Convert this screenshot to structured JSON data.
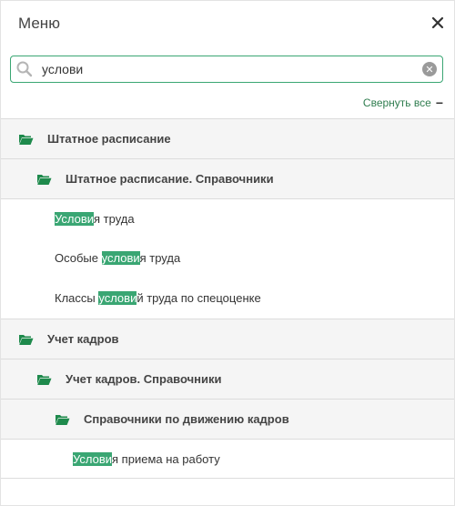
{
  "header": {
    "title": "Меню"
  },
  "search": {
    "value": "услови",
    "placeholder": ""
  },
  "collapse": {
    "label": "Свернуть все",
    "icon": "minus"
  },
  "colors": {
    "accent": "#3aa673",
    "folder": "#1e8a4c",
    "group_bg": "#f5f5f5"
  },
  "tree": [
    {
      "type": "group",
      "level": 0,
      "label": "Штатное расписание"
    },
    {
      "type": "group",
      "level": 1,
      "label": "Штатное расписание. Справочники"
    },
    {
      "type": "leaf",
      "level": 2,
      "pre": "",
      "match": "Услови",
      "post": "я труда"
    },
    {
      "type": "leaf",
      "level": 2,
      "pre": "Особые ",
      "match": "услови",
      "post": "я труда"
    },
    {
      "type": "leaf",
      "level": 2,
      "pre": "Классы ",
      "match": "услови",
      "post": "й труда по спецоценке"
    },
    {
      "type": "group",
      "level": 0,
      "label": "Учет кадров"
    },
    {
      "type": "group",
      "level": 1,
      "label": "Учет кадров. Справочники"
    },
    {
      "type": "group",
      "level": 2,
      "label": "Справочники по движению кадров"
    },
    {
      "type": "leaf",
      "level": 3,
      "pre": "",
      "match": "Услови",
      "post": "я приема на работу"
    }
  ]
}
